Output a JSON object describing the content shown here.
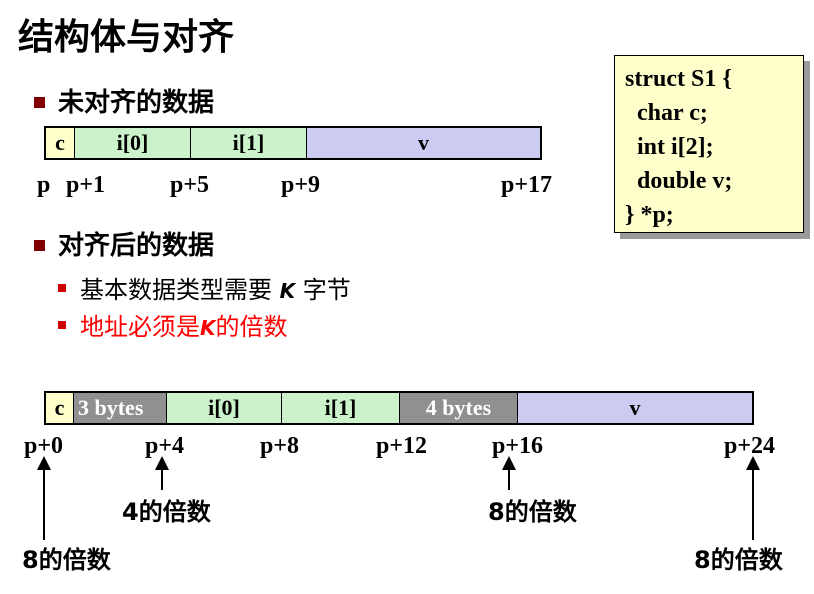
{
  "title": "结构体与对齐",
  "section_unaligned": "未对齐的数据",
  "section_aligned": "对齐后的数据",
  "rule_size": "基本数据类型需要 K 字节",
  "rule_size_prefix": "基本数据类型需要 ",
  "rule_size_k": "K",
  "rule_size_suffix": " 字节",
  "rule_address": "地址必须是K的倍数",
  "rule_address_prefix": "地址必须是",
  "rule_address_k": "K",
  "rule_address_suffix": "的倍数",
  "colors": {
    "char": "#ffffcc",
    "int": "#ccf2cc",
    "double": "#ccccf2",
    "padding": "#909090",
    "bullet": "#800000",
    "highlight": "#ff0000"
  },
  "code": {
    "line1": "struct S1 {",
    "line2": "  char c;",
    "line3": "  int i[2];",
    "line4": "  double v;",
    "line5": "} *p;"
  },
  "unaligned": {
    "cells": [
      "c",
      "i[0]",
      "i[1]",
      "v"
    ],
    "offsets": [
      "p",
      "p+1",
      "p+5",
      "p+9",
      "p+17"
    ]
  },
  "aligned": {
    "cells": [
      "c",
      "3 bytes",
      "i[0]",
      "i[1]",
      "4 bytes",
      "v"
    ],
    "offsets": [
      "p+0",
      "p+4",
      "p+8",
      "p+12",
      "p+16",
      "p+24"
    ],
    "notes": {
      "four_multiple": "4的倍数",
      "eight_multiple_a": "8的倍数",
      "eight_multiple_b": "8的倍数",
      "eight_multiple_c": "8的倍数"
    }
  }
}
